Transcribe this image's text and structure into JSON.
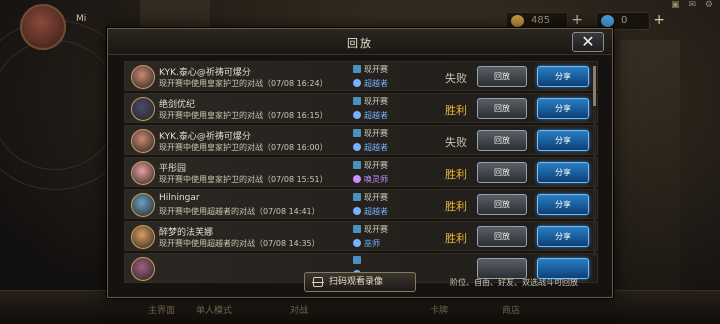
{
  "background": {
    "player_name": "Mi",
    "player_sub": "",
    "resources": [
      {
        "name": "coin",
        "value": "485",
        "icon": "gold-coin-icon",
        "color": "#c9a040"
      },
      {
        "name": "gem",
        "value": "0",
        "icon": "blue-gem-icon",
        "color": "#4aa0e0"
      }
    ],
    "bottom_nav": [
      "主界面",
      "单人模式",
      "对战",
      "卡牌",
      "商店"
    ]
  },
  "dialog": {
    "title": "回放",
    "close_icon": "close-icon",
    "rows": [
      {
        "name": "KYK.泰心@祈祷可爆分",
        "desc": "现开赛中使用皇家护卫的对战（07/08 16:24）",
        "mode": "现开赛",
        "role": "超越者",
        "role_color": "#7ab0ff",
        "result": "失败",
        "result_color": "#c8c0b0",
        "replay": "回放",
        "share": "分享",
        "avatar_color": "#c98a70"
      },
      {
        "name": "绝剑优纪",
        "desc": "现开赛中使用皇家护卫的对战（07/08 16:15）",
        "mode": "现开赛",
        "role": "超越者",
        "role_color": "#7ab0ff",
        "result": "胜利",
        "result_color": "#e8b830",
        "replay": "回放",
        "share": "分享",
        "avatar_color": "#4a4a6a"
      },
      {
        "name": "KYK.泰心@祈祷可爆分",
        "desc": "现开赛中使用皇家护卫的对战（07/08 16:00）",
        "mode": "现开赛",
        "role": "超越者",
        "role_color": "#7ab0ff",
        "result": "失败",
        "result_color": "#c8c0b0",
        "replay": "回放",
        "share": "分享",
        "avatar_color": "#c98a70"
      },
      {
        "name": "平彤园",
        "desc": "现开赛中使用皇家护卫的对战（07/08 15:51）",
        "mode": "现开赛",
        "role": "唤灵师",
        "role_color": "#c890ff",
        "result": "胜利",
        "result_color": "#e8b830",
        "replay": "回放",
        "share": "分享",
        "avatar_color": "#e8a0a0"
      },
      {
        "name": "Hilningar",
        "desc": "现开赛中使用超越者的对战（07/08 14:41）",
        "mode": "现开赛",
        "role": "超越者",
        "role_color": "#7ab0ff",
        "result": "胜利",
        "result_color": "#e8b830",
        "replay": "回放",
        "share": "分享",
        "avatar_color": "#6aa0c0"
      },
      {
        "name": "醉梦的法芙娜",
        "desc": "现开赛中使用超越者的对战（07/08 14:35）",
        "mode": "现开赛",
        "role": "巫师",
        "role_color": "#7ab0ff",
        "result": "胜利",
        "result_color": "#e8b830",
        "replay": "回放",
        "share": "分享",
        "avatar_color": "#d8a060"
      },
      {
        "name": "",
        "desc": "",
        "mode": "",
        "role": "",
        "role_color": "#7ab0ff",
        "result": "",
        "result_color": "#e8b830",
        "replay": "",
        "share": "",
        "avatar_color": "#a06080"
      }
    ],
    "scan_button": "扫码观看录像",
    "scan_icon": "qr-scan-icon",
    "footnote": "阶位、自由、好友、双选战斗可回放"
  }
}
